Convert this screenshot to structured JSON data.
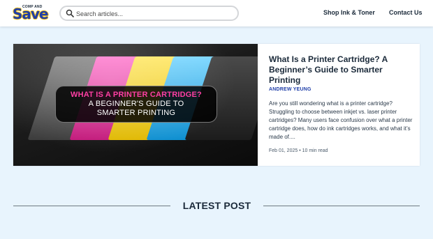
{
  "header": {
    "logo_small": "COMP AND",
    "logo_big": "Save",
    "search_placeholder": "Search articles...",
    "nav": [
      {
        "label": "Shop Ink & Toner"
      },
      {
        "label": "Contact Us"
      }
    ]
  },
  "featured": {
    "image_line1": "WHAT IS A PRINTER CARTRIDGE?",
    "image_line2": "A BEGINNER'S GUIDE TO",
    "image_line3": "SMARTER PRINTING",
    "title": "What Is a Printer Cartridge? A Beginner’s Guide to Smarter Printing",
    "author": "ANDREW YEUNG",
    "excerpt": "Are you still wondering what is a printer cartridge? Struggling to choose between inkjet vs. laser printer cartridges? Many users face confusion over what a printer cartridge does, how do ink cartridges works, and what it’s made of....",
    "meta": "Feb 01, 2025 • 10 min read"
  },
  "latest": {
    "title": "LATEST POST"
  },
  "colors": {
    "accent": "#1f3ea8",
    "highlight": "#ff3fa4",
    "background": "#e8f4fd"
  }
}
